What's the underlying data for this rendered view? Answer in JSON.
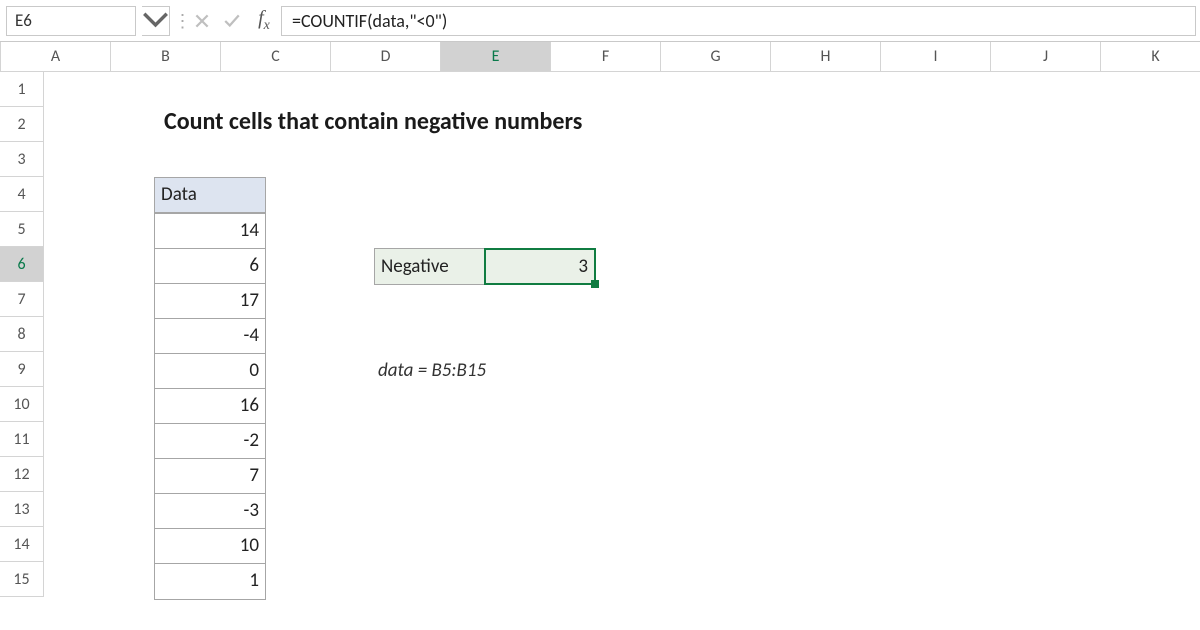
{
  "formula_bar": {
    "cell_ref": "E6",
    "formula": "=COUNTIF(data,\"<0\")"
  },
  "columns": [
    "A",
    "B",
    "C",
    "D",
    "E",
    "F",
    "G",
    "H",
    "I",
    "J",
    "K"
  ],
  "active_col": "E",
  "rows": [
    "1",
    "2",
    "3",
    "4",
    "5",
    "6",
    "7",
    "8",
    "9",
    "10",
    "11",
    "12",
    "13",
    "14",
    "15"
  ],
  "active_row": "6",
  "sheet": {
    "title": "Count cells that contain negative numbers",
    "data_header": "Data",
    "data_values": [
      "14",
      "6",
      "17",
      "-4",
      "0",
      "16",
      "-2",
      "7",
      "-3",
      "10",
      "1"
    ],
    "result_label": "Negative",
    "result_value": "3",
    "range_note": "data = B5:B15"
  }
}
